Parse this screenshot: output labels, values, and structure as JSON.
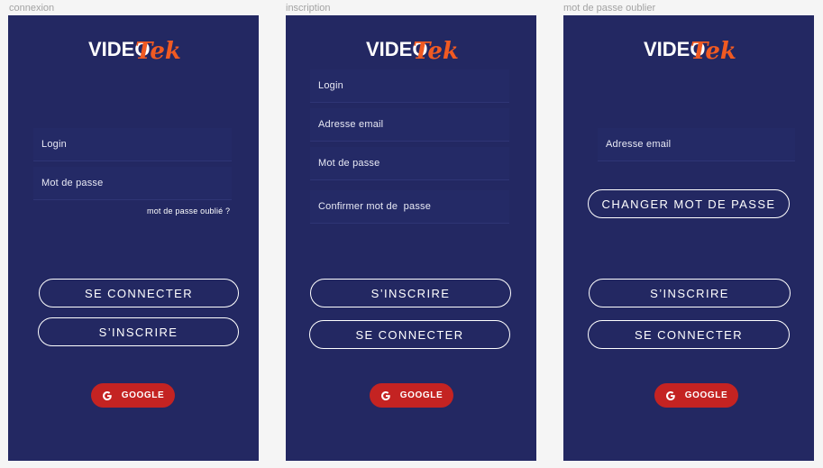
{
  "brand": {
    "logo_part1": "VIDEO",
    "logo_part2": "Tek",
    "accent_color": "#f05a22",
    "frame_bg": "#232862",
    "google_red": "#c42322"
  },
  "frames": {
    "connexion": {
      "label": "connexion",
      "login_placeholder": "Login",
      "password_placeholder": "Mot de passe",
      "forgot_link": "mot de passe oublié ?",
      "connect_button": "SE CONNECTER",
      "signup_button": "S’INSCRIRE",
      "google_button": "GOOGLE"
    },
    "inscription": {
      "label": "inscription",
      "login_placeholder": "Login",
      "email_placeholder": "Adresse email",
      "password_placeholder": "Mot de passe",
      "confirm_placeholder": "Confirmer mot de  passe",
      "signup_button": "S’INSCRIRE",
      "connect_button": "SE CONNECTER",
      "google_button": "GOOGLE"
    },
    "forgot": {
      "label": "mot de passe oublier",
      "email_placeholder": "Adresse email",
      "change_password_button": "CHANGER MOT DE PASSE",
      "signup_button": "S’INSCRIRE",
      "connect_button": "SE CONNECTER",
      "google_button": "GOOGLE"
    }
  }
}
